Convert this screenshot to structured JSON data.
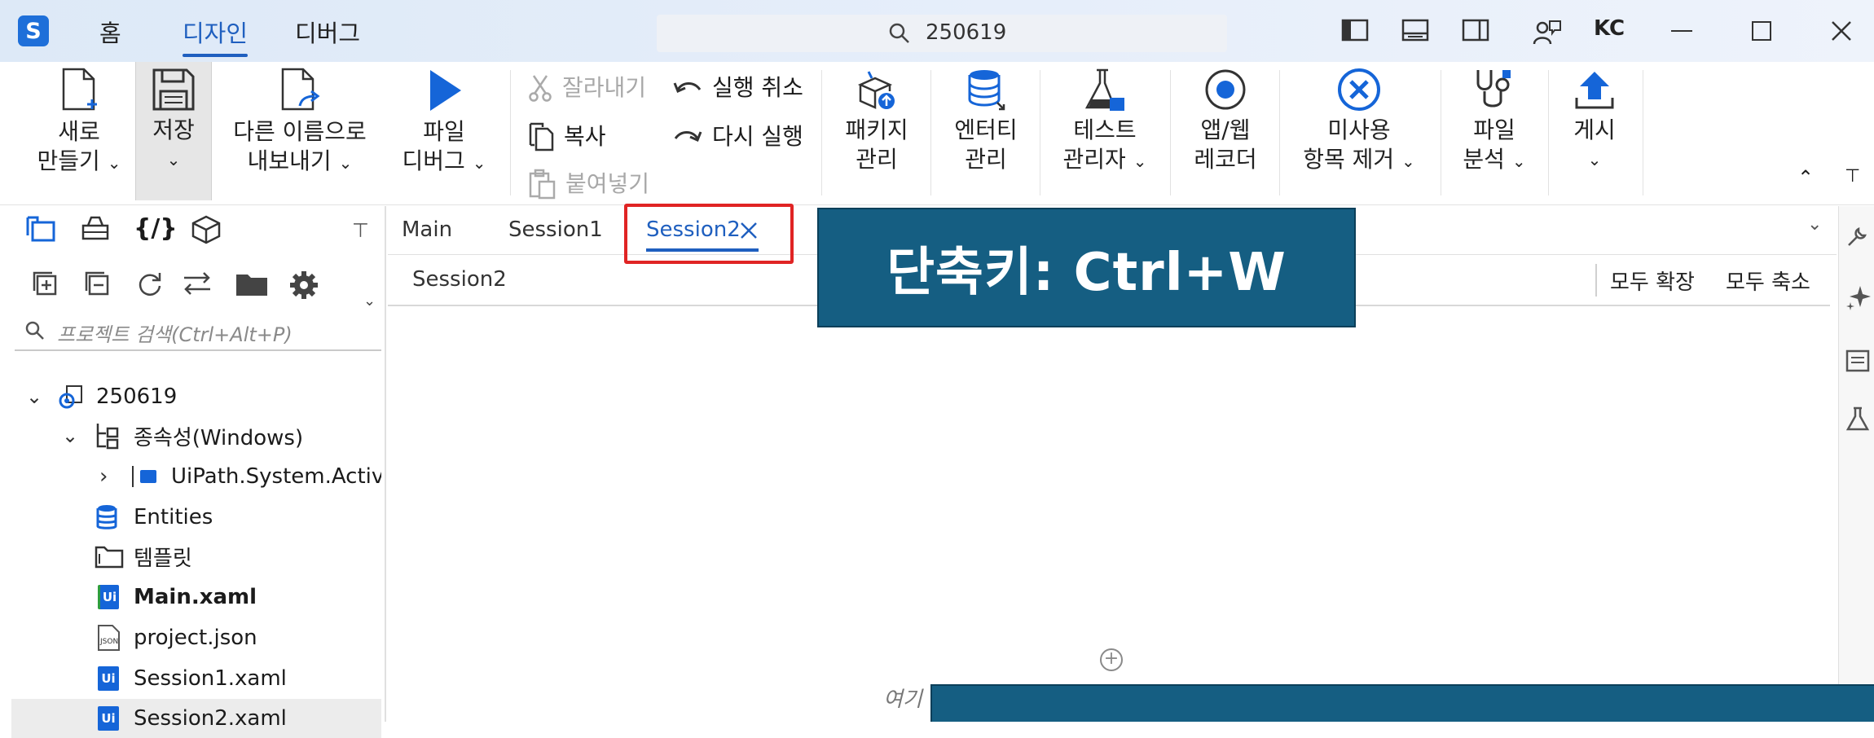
{
  "titlebar": {
    "menu": [
      "홈",
      "디자인",
      "디버그"
    ],
    "search_text": "250619",
    "user_initials": "KC"
  },
  "ribbon": {
    "new_label_1": "새로",
    "new_label_2": "만들기",
    "save_label": "저장",
    "export_label_1": "다른 이름으로",
    "export_label_2": "내보내기",
    "debug_label_1": "파일",
    "debug_label_2": "디버그",
    "cut": "잘라내기",
    "copy": "복사",
    "paste": "붙여넣기",
    "undo": "실행 취소",
    "redo": "다시 실행",
    "packages_1": "패키지",
    "packages_2": "관리",
    "entities_1": "엔터티",
    "entities_2": "관리",
    "test_1": "테스트",
    "test_2": "관리자",
    "recorder_1": "앱/웹",
    "recorder_2": "레코더",
    "unused_1": "미사용",
    "unused_2": "항목 제거",
    "analyze_1": "파일",
    "analyze_2": "분석",
    "publish": "게시"
  },
  "project_panel": {
    "search_placeholder": "프로젝트 검색(Ctrl+Alt+P)",
    "tree": {
      "root": "250619",
      "deps": "종속성(Windows)",
      "dep_pkg": "UiPath.System.Activities",
      "entities": "Entities",
      "templates": "템플릿",
      "main": "Main.xaml",
      "project_json": "project.json",
      "session1": "Session1.xaml",
      "session2": "Session2.xaml"
    }
  },
  "doc_tabs": {
    "tabs": [
      "Main",
      "Session1",
      "Session2"
    ],
    "active": "Session2"
  },
  "designer": {
    "breadcrumb": "Session2",
    "expand_all": "모두 확장",
    "collapse_all": "모두 축소",
    "drop_hint": "여기"
  },
  "overlay": {
    "shortcut": "단축키: Ctrl+W"
  },
  "colors": {
    "accent": "#1f5fbf",
    "highlight_box": "#e02424",
    "banner": "#155e82"
  }
}
